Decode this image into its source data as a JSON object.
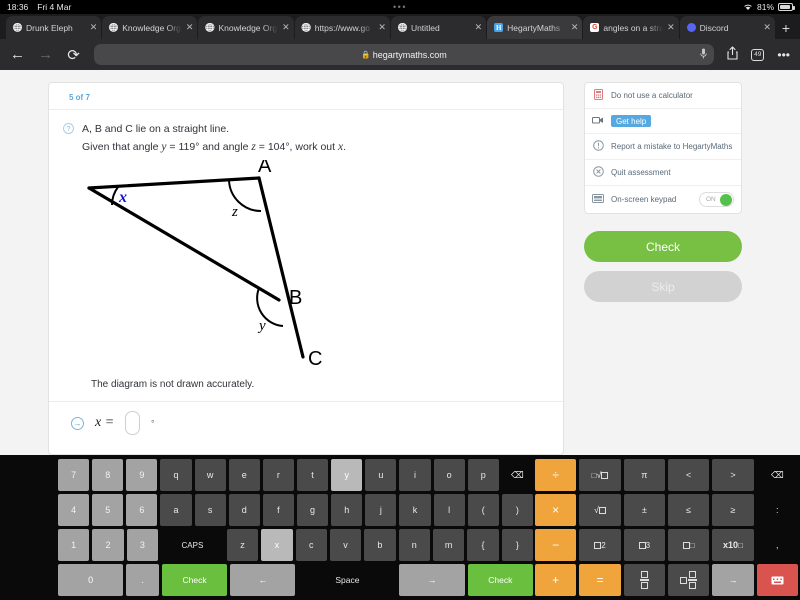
{
  "status_bar": {
    "time": "18:36",
    "date": "Fri 4 Mar",
    "dots": "•••",
    "wifi_icon": "wifi-icon",
    "battery_percent": "81%"
  },
  "tabs": [
    {
      "title": "Drunk Eleph",
      "favicon": "globe-icon",
      "active": false,
      "close": "✕"
    },
    {
      "title": "Knowledge Org",
      "favicon": "globe-icon",
      "active": false,
      "close": "✕"
    },
    {
      "title": "Knowledge Org",
      "favicon": "globe-icon",
      "active": false,
      "close": "✕"
    },
    {
      "title": "https://www.go",
      "favicon": "globe-icon",
      "active": false,
      "close": "✕"
    },
    {
      "title": "Untitled",
      "favicon": "globe-icon",
      "active": false,
      "close": "✕"
    },
    {
      "title": "HegartyMaths",
      "favicon": "hegarty-icon",
      "active": true,
      "close": "✕"
    },
    {
      "title": "angles on a stra",
      "favicon": "google-icon",
      "active": false,
      "close": "✕"
    },
    {
      "title": "Discord",
      "favicon": "discord-icon",
      "active": false,
      "close": "✕"
    }
  ],
  "new_tab_label": "+",
  "address_bar": {
    "back": "←",
    "forward": "→",
    "reload": "⟳",
    "lock": "🔒",
    "url": "hegartymaths.com",
    "mic": "🎤",
    "share": "share-icon",
    "tab_count": "49",
    "more": "•••"
  },
  "question": {
    "progress": "5 of 7",
    "help_icon": "?",
    "line1": "A, B and C lie on a straight line.",
    "line2_pre": "Given that angle ",
    "var_y": "y",
    "line2_mid": " = 119° and angle ",
    "var_z": "z",
    "line2_post": " = 104°, work out ",
    "var_x": "x",
    "line2_end": ".",
    "note": "The diagram is not drawn accurately.",
    "answer_label": "x =",
    "answer_value": "",
    "degree": "°",
    "submit_arrow": "→",
    "diagram": {
      "label_a": "A",
      "label_b": "B",
      "label_c": "C",
      "angle_x": "x",
      "angle_y": "y",
      "angle_z": "z"
    }
  },
  "sidebar": {
    "options": [
      {
        "icon": "calculator-icon",
        "label": "Do not use a calculator",
        "style": "plain"
      },
      {
        "icon": "video-icon",
        "label": "Get help",
        "style": "badge"
      },
      {
        "icon": "warning-icon",
        "label": "Report a mistake to HegartyMaths",
        "style": "plain"
      },
      {
        "icon": "quit-icon",
        "label": "Quit assessment",
        "style": "plain"
      },
      {
        "icon": "keyboard-icon",
        "label": "On-screen keypad",
        "style": "toggle",
        "toggle_text": "ON",
        "toggle_on": true
      }
    ],
    "check_label": "Check",
    "skip_label": "Skip"
  },
  "keyboard": {
    "rows_left": [
      [
        {
          "label": "7",
          "type": "num"
        },
        {
          "label": "8",
          "type": "num"
        },
        {
          "label": "9",
          "type": "num"
        },
        {
          "label": "q",
          "type": "lit"
        },
        {
          "label": "w",
          "type": "lit"
        },
        {
          "label": "e",
          "type": "lit"
        },
        {
          "label": "r",
          "type": "lit"
        },
        {
          "label": "t",
          "type": "lit"
        },
        {
          "label": "y",
          "type": "hi"
        },
        {
          "label": "u",
          "type": "lit"
        },
        {
          "label": "i",
          "type": "lit"
        },
        {
          "label": "o",
          "type": "lit"
        },
        {
          "label": "p",
          "type": "lit"
        },
        {
          "label": "⌫",
          "type": "dark"
        }
      ],
      [
        {
          "label": "4",
          "type": "num"
        },
        {
          "label": "5",
          "type": "num"
        },
        {
          "label": "6",
          "type": "num"
        },
        {
          "label": "a",
          "type": "lit"
        },
        {
          "label": "s",
          "type": "lit"
        },
        {
          "label": "d",
          "type": "lit"
        },
        {
          "label": "f",
          "type": "lit"
        },
        {
          "label": "g",
          "type": "lit"
        },
        {
          "label": "h",
          "type": "lit"
        },
        {
          "label": "j",
          "type": "lit"
        },
        {
          "label": "k",
          "type": "lit"
        },
        {
          "label": "l",
          "type": "lit"
        },
        {
          "label": "(",
          "type": "lit"
        },
        {
          "label": ")",
          "type": "lit"
        }
      ],
      [
        {
          "label": "1",
          "type": "num"
        },
        {
          "label": "2",
          "type": "num"
        },
        {
          "label": "3",
          "type": "num"
        },
        {
          "label": "CAPS",
          "type": "caps",
          "w": "w2"
        },
        {
          "label": "z",
          "type": "lit"
        },
        {
          "label": "x",
          "type": "hi"
        },
        {
          "label": "c",
          "type": "lit"
        },
        {
          "label": "v",
          "type": "lit"
        },
        {
          "label": "b",
          "type": "lit"
        },
        {
          "label": "n",
          "type": "lit"
        },
        {
          "label": "m",
          "type": "lit"
        },
        {
          "label": "{",
          "type": "lit"
        },
        {
          "label": "}",
          "type": "lit"
        }
      ],
      [
        {
          "label": "0",
          "type": "grey",
          "w": "w2"
        },
        {
          "label": ".",
          "type": "grey"
        },
        {
          "label": "Check",
          "type": "green",
          "w": "w2"
        },
        {
          "label": "←",
          "type": "grey",
          "w": "w2"
        },
        {
          "label": "Space",
          "type": "sp",
          "w": "w3"
        },
        {
          "label": "→",
          "type": "grey",
          "w": "w2"
        },
        {
          "label": "Check",
          "type": "green",
          "w": "w2"
        }
      ]
    ],
    "rows_right": [
      [
        {
          "label": "÷",
          "type": "orange"
        },
        {
          "label": "nth-root",
          "type": "lit"
        },
        {
          "label": "π",
          "type": "lit"
        },
        {
          "label": "<",
          "type": "lit"
        },
        {
          "label": ">",
          "type": "lit"
        },
        {
          "label": "⌫",
          "type": "dark"
        }
      ],
      [
        {
          "label": "×",
          "type": "orange"
        },
        {
          "label": "sqrt",
          "type": "lit"
        },
        {
          "label": "±",
          "type": "lit"
        },
        {
          "label": "≤",
          "type": "lit"
        },
        {
          "label": "≥",
          "type": "lit"
        },
        {
          "label": ":",
          "type": "dark"
        }
      ],
      [
        {
          "label": "−",
          "type": "orange"
        },
        {
          "label": "square",
          "type": "lit"
        },
        {
          "label": "cube",
          "type": "lit"
        },
        {
          "label": "power",
          "type": "lit"
        },
        {
          "label": "x10",
          "type": "lit"
        },
        {
          "label": ",",
          "type": "dark"
        }
      ],
      [
        {
          "label": "+",
          "type": "orange"
        },
        {
          "label": "=",
          "type": "orange"
        },
        {
          "label": "frac",
          "type": "lit"
        },
        {
          "label": "mixed",
          "type": "lit"
        },
        {
          "label": "→",
          "type": "grey"
        },
        {
          "label": "hide-keyboard",
          "type": "red"
        }
      ]
    ]
  }
}
